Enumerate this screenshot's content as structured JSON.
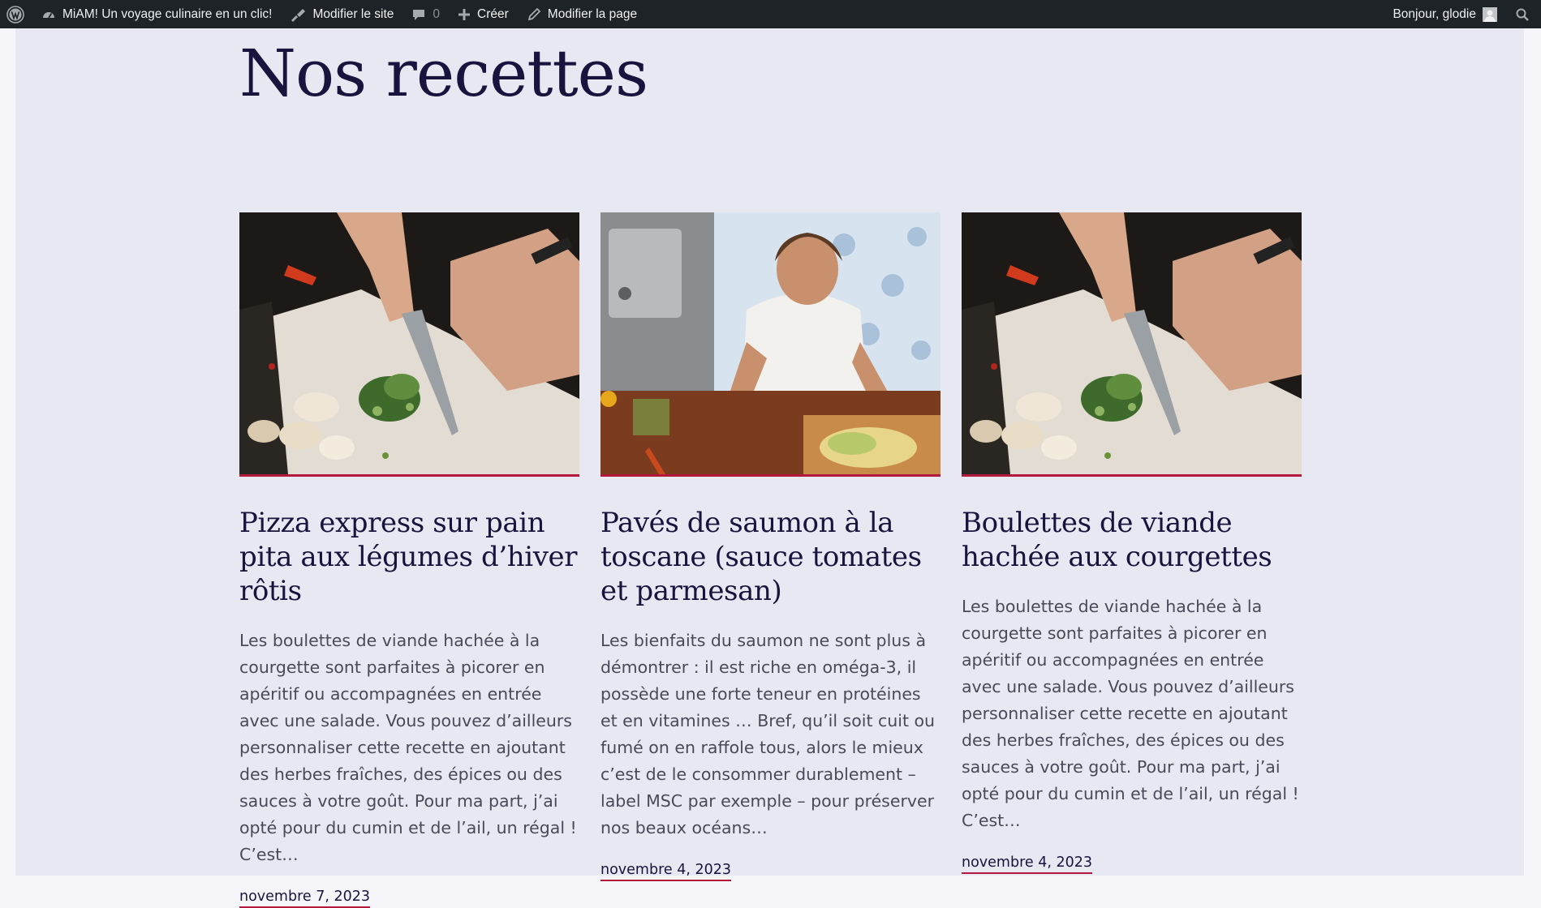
{
  "adminbar": {
    "site_name": "MiAM! Un voyage culinaire en un clic!",
    "edit_site": "Modifier le site",
    "comments_count": "0",
    "new_label": "Créer",
    "edit_page": "Modifier la page",
    "greeting": "Bonjour, glodie"
  },
  "page": {
    "title": "Nos recettes"
  },
  "posts": [
    {
      "title": "Pizza express sur pain pita aux légumes d’hiver rôtis",
      "excerpt": "Les boulettes de viande hachée à la courgette sont parfaites à picorer en apéritif ou accompagnées en entrée avec une salade. Vous pouvez d’ailleurs personnaliser cette recette en ajoutant des herbes fraîches, des épices ou des sauces à votre goût. Pour ma part, j’ai opté pour du cumin et de l’ail, un régal ! C’est…",
      "date": "novembre 7, 2023",
      "image": "hands chopping green vegetables with mushrooms on a cutting board"
    },
    {
      "title": "Pavés de saumon à la toscane (sauce tomates et parmesan)",
      "excerpt": "Les bienfaits du saumon ne sont plus à démontrer : il est riche en oméga-3, il possède une forte teneur en protéines et en vitamines … Bref, qu’il soit cuit ou fumé on en raffole tous, alors le mieux c’est de le consommer durablement – label MSC par exemple – pour préserver nos beaux océans…",
      "date": "novembre 4, 2023",
      "image": "smiling woman cutting vegetables in a kitchen, top view"
    },
    {
      "title": "Boulettes de viande hachée aux courgettes",
      "excerpt": "Les boulettes de viande hachée à la courgette sont parfaites à picorer en apéritif ou accompagnées en entrée avec une salade. Vous pouvez d’ailleurs personnaliser cette recette en ajoutant des herbes fraîches, des épices ou des sauces à votre goût. Pour ma part, j’ai opté pour du cumin et de l’ail, un régal ! C’est…",
      "date": "novembre 4, 2023",
      "image": "hands chopping green vegetables with mushrooms on a cutting board"
    }
  ],
  "colors": {
    "adminbar_bg": "#1d2327",
    "page_bg": "#e8e8f3",
    "heading": "#17143d",
    "accent": "#b2193d"
  }
}
